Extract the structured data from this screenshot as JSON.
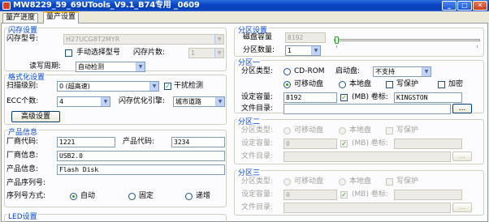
{
  "window": {
    "title": "MW8229_59_69UTools_V9.1_B74专用 _0609",
    "minimize": "_",
    "maximize": "□",
    "close": "✕"
  },
  "tabs": [
    "量产进度",
    "量产设置"
  ],
  "flash": {
    "title": "闪存设置",
    "type_label": "闪存型号:",
    "type_value": "H27UCG8T2MYR",
    "manual_label": "手动选择型号",
    "chips_label": "闪存片数:",
    "chips_value": "1",
    "read_cycle_label": "读写周期:",
    "read_cycle_value": "自动检测"
  },
  "format": {
    "title": "格式化设置",
    "scan_label": "扫描级别:",
    "scan_value": "0 (超高速)",
    "interference_label": "干扰检测",
    "ecc_label": "ECC个数:",
    "ecc_value": "4",
    "optimize_label": "闪存优化引擎:",
    "optimize_value": "城市道路",
    "advanced_button": "高级设置"
  },
  "product": {
    "title": "产品信息",
    "vendor_code_label": "厂商代码:",
    "vendor_code_value": "1221",
    "product_code_label": "产品代码:",
    "product_code_value": "3234",
    "vendor_info_label": "厂商信息:",
    "vendor_info_value": "USB2.0",
    "product_info_label": "产品信息:",
    "product_info_value": "Flash Disk",
    "serial_label": "产品序列号:",
    "serial_mode_label": "序列号方式:",
    "serial_modes": [
      "自动",
      "固定",
      "递增"
    ]
  },
  "led": {
    "title": "LED设置"
  },
  "partition": {
    "title": "分区设置",
    "capacity_label": "磁盘容量",
    "capacity_value": "8192",
    "count_label": "分区数量:",
    "count_value": "1"
  },
  "partitions": [
    {
      "title": "分区一",
      "type_label": "分区类型:",
      "cdrom_label": "CD-ROM",
      "boot_label": "启动盘:",
      "boot_value": "不支持",
      "removable_label": "可移动盘",
      "local_label": "本地盘",
      "write_protect_label": "写保护",
      "encrypt_label": "加密",
      "capacity_label": "设定容量:",
      "capacity_value": "8192",
      "unit_label": "(MB) 卷标:",
      "volume_value": "KINGSTON",
      "dir_label": "文件目录:",
      "browse_label": "..."
    },
    {
      "title": "分区二",
      "type_label": "分区类型:",
      "removable_label": "可移动盘",
      "local_label": "本地盘",
      "write_protect_label": "写保护",
      "capacity_label": "设定容量:",
      "capacity_value": "0",
      "unit_label": "(MB) 卷标:",
      "dir_label": "文件目录:",
      "browse_label": "..."
    },
    {
      "title": "分区三",
      "type_label": "分区类型:",
      "removable_label": "可移动盘",
      "local_label": "本地盘",
      "write_protect_label": "写保护",
      "capacity_label": "设定容量:",
      "capacity_value": "0",
      "unit_label": "(MB) 卷标:",
      "dir_label": "文件目录:",
      "browse_label": "..."
    }
  ],
  "icons": {
    "check": "✓",
    "dropdown": "▼"
  },
  "colors": {
    "title_bar": "#0a46c8",
    "group_title": "#0046d5",
    "check_green": "#21a121"
  }
}
